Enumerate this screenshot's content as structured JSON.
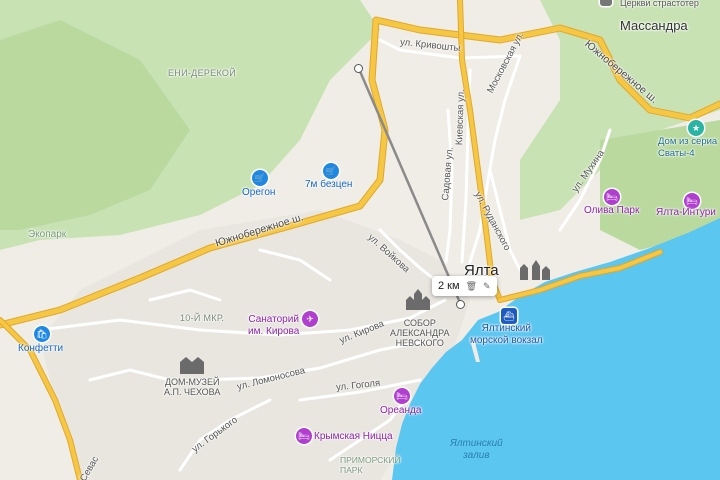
{
  "map": {
    "colors": {
      "land": "#efede6",
      "forest": "#c8e2b4",
      "forest_dark": "#b9d99e",
      "sea": "#5bc6f0",
      "road_main": "#f6c744",
      "road_outline": "#e0a82c",
      "road_minor": "#ffffff",
      "ruler_line": "#8a8a8a"
    },
    "cities": {
      "yalta": "Ялта",
      "massandra": "Массандра",
      "top_partial": "Церкви страстотер"
    },
    "districts": {
      "eni_derekoi": "ЕНИ-ДЕРЕКОЙ",
      "mkr10": "10-Й МКР."
    },
    "parks": {
      "ekopark": "Экопарк",
      "primorsky": "ПРИМОРСКИЙ ПАРК"
    },
    "streets": {
      "kryvoshty": "ул. Кривошты",
      "moskovskaya": "Московская ул.",
      "kievskaya": "Киевская ул.",
      "sadovaya": "Садовая ул.",
      "rudanskogo": "ул. Руданского",
      "voikova": "ул. Войкова",
      "kirova": "ул. Кирова",
      "lomonosova": "ул. Ломоносова",
      "gogolya": "ул. Гоголя",
      "gorkogo": "ул. Горького",
      "sevastopolskaya": "Севас",
      "yuzhnoberezhnoe_w": "Южнобережное ш.",
      "yuzhnoberezhnoe_e": "Южнобережное ш.",
      "mutina": "ул. Мухина"
    },
    "pois": {
      "oregon": {
        "label": "Орегон",
        "icon": "shopping-cart-icon",
        "glyph": "🛒"
      },
      "sem_m": {
        "label": "7м безцен",
        "icon": "shopping-cart-icon",
        "glyph": "🛒"
      },
      "konfetti": {
        "label": "Конфетти",
        "icon": "shopping-bag-icon",
        "glyph": "🛍"
      },
      "sanatorium": {
        "label": "Санаторий\nим. Кирова",
        "icon": "airplane-icon",
        "glyph": "✈"
      },
      "oliva": {
        "label": "Олива Парк",
        "icon": "hotel-icon",
        "glyph": "🛏"
      },
      "yalta_inturist": {
        "label": "Ялта-Интури",
        "icon": "hotel-icon",
        "glyph": "🛏"
      },
      "oreanda": {
        "label": "Ореанда",
        "icon": "hotel-icon",
        "glyph": "🛏"
      },
      "krymskaya_nitsa": {
        "label": "Крымская Ницца",
        "icon": "hotel-icon",
        "glyph": "🛏"
      },
      "dom_iz_seriala": {
        "label": "Дом из сериа\nСваты-4",
        "icon": "star-icon",
        "glyph": "★"
      },
      "morskoi_vokzal": {
        "label": "Ялтинский\nморской вокзал",
        "icon": "ferry-icon",
        "glyph": "⛴"
      }
    },
    "sights": {
      "sobor": "СОБОР\nАЛЕКСАНДРА\nНЕВСКОГО",
      "chekhov": "ДОМ-МУЗЕЙ\nА.П. ЧЕХОВА"
    },
    "water": {
      "bay": "Ялтинский\nзалив"
    },
    "ruler": {
      "distance": "2 км",
      "delete_icon": "trash-icon",
      "edit_icon": "pencil-icon"
    }
  }
}
